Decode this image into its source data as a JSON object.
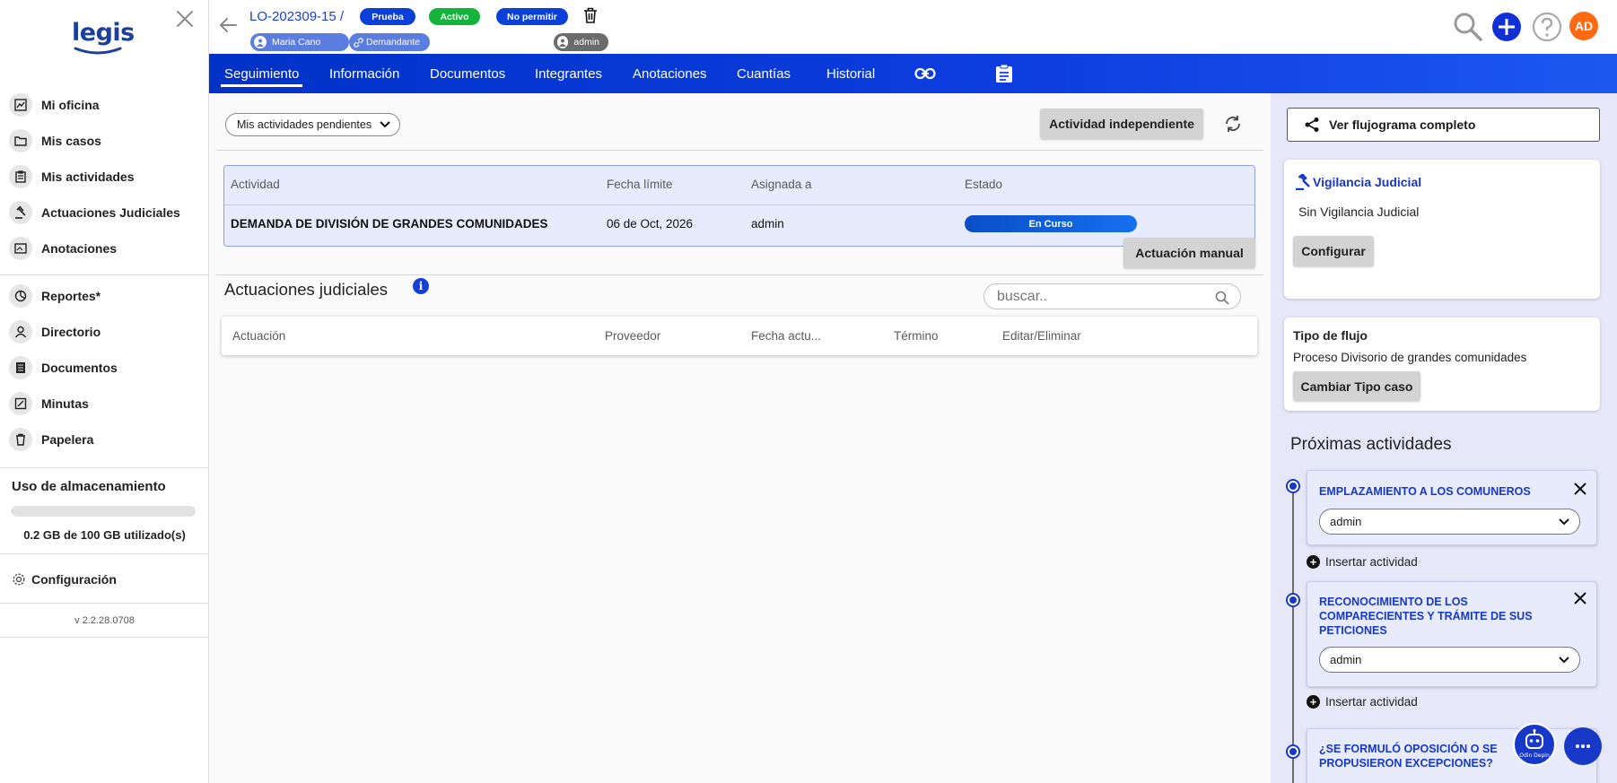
{
  "sidebar": {
    "logo": "legis",
    "nav_primary": [
      {
        "label": "Mi oficina",
        "icon": "chart-icon"
      },
      {
        "label": "Mis casos",
        "icon": "folder-icon"
      },
      {
        "label": "Mis actividades",
        "icon": "clipboard-icon"
      },
      {
        "label": "Actuaciones Judiciales",
        "icon": "gavel-icon"
      },
      {
        "label": "Anotaciones",
        "icon": "note-icon"
      }
    ],
    "nav_secondary": [
      {
        "label": "Reportes*",
        "icon": "pie-icon"
      },
      {
        "label": "Directorio",
        "icon": "person-icon"
      },
      {
        "label": "Documentos",
        "icon": "document-icon"
      },
      {
        "label": "Minutas",
        "icon": "edit-icon"
      },
      {
        "label": "Papelera",
        "icon": "trash-icon"
      }
    ],
    "storage": {
      "title": "Uso de almacenamiento",
      "used_text": "0.2 GB de 100 GB utilizado(s)",
      "used_fraction": 0.002
    },
    "config_label": "Configuración",
    "version": "v 2.2.28.0708"
  },
  "header": {
    "case_id": "LO-202309-15 /",
    "badges": [
      {
        "label": "Prueba",
        "color": "#0a3fd8"
      },
      {
        "label": "Activo",
        "color": "#14b43c"
      },
      {
        "label": "No permitir",
        "color": "#0a3fd8"
      }
    ],
    "chips": [
      {
        "label": "Maria Cano"
      },
      {
        "label": "Demandante"
      },
      {
        "label": "admin"
      }
    ],
    "avatar_initials": "AD"
  },
  "tabs": [
    {
      "label": "Seguimiento",
      "active": true
    },
    {
      "label": "Información"
    },
    {
      "label": "Documentos"
    },
    {
      "label": "Integrantes"
    },
    {
      "label": "Anotaciones"
    },
    {
      "label": "Cuantías"
    },
    {
      "label": "Historial"
    }
  ],
  "main": {
    "filter_label": "Mis actividades pendientes",
    "independent_btn": "Actividad independiente",
    "activities_table": {
      "headers": [
        "Actividad",
        "Fecha límite",
        "Asignada a",
        "Estado"
      ],
      "row": {
        "actividad": "DEMANDA DE DIVISIÓN DE GRANDES COMUNIDADES",
        "fecha": "06 de Oct, 2026",
        "asignada": "admin",
        "estado": "En Curso"
      }
    },
    "actuaciones_title": "Actuaciones judiciales",
    "manual_btn": "Actuación manual",
    "search_placeholder": "buscar..",
    "actuaciones_headers": [
      "Actuación",
      "Proveedor",
      "Fecha actu...",
      "Término",
      "Editar/Eliminar"
    ]
  },
  "right": {
    "flow_btn": "Ver flujograma completo",
    "vigilancia": {
      "title": "Vigilancia Judicial",
      "text": "Sin Vigilancia Judicial",
      "btn": "Configurar"
    },
    "tipo_flujo": {
      "title": "Tipo de flujo",
      "text": "Proceso Divisorio de grandes comunidades",
      "btn": "Cambiar Tipo caso"
    },
    "proximas_title": "Próximas actividades",
    "next_activities": [
      {
        "title_lines": [
          "EMPLAZAMIENTO A LOS COMUNEROS"
        ],
        "assignee": "admin"
      },
      {
        "title_lines": [
          "RECONOCIMIENTO DE LOS",
          "COMPARECIENTES Y TRÁMITE DE SUS",
          "PETICIONES"
        ],
        "assignee": "admin"
      },
      {
        "title_lines": [
          "¿SE FORMULÓ OPOSICIÓN O SE",
          "PROPUSIERON EXCEPCIONES?"
        ]
      }
    ],
    "insert_label": "Insertar actividad",
    "bot_label": "Odin Depin"
  }
}
